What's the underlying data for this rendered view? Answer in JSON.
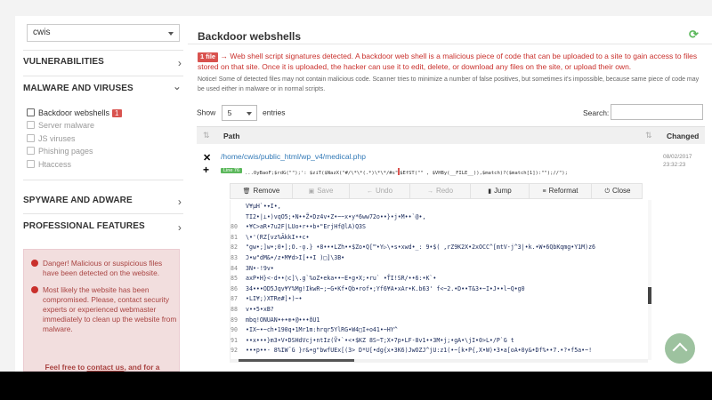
{
  "site_select": {
    "value": "cwis"
  },
  "sidebar": {
    "sections": [
      {
        "label": "VULNERABILITIES",
        "chevron": "›"
      },
      {
        "label": "MALWARE AND VIRUSES",
        "chevron": "⌄"
      },
      {
        "label": "SPYWARE AND ADWARE",
        "chevron": "›"
      },
      {
        "label": "PROFESSIONAL FEATURES",
        "chevron": "›"
      }
    ],
    "malware_items": [
      {
        "label": "Backdoor webshells",
        "badge": "1"
      },
      {
        "label": "Server malware"
      },
      {
        "label": "JS viruses"
      },
      {
        "label": "Phishing pages"
      },
      {
        "label": "Htaccess"
      }
    ]
  },
  "alert": {
    "line1": "Danger! Malicious or suspicious files have been detected on the website.",
    "line2": "Most likely the website has been compromised. Please, contact security experts or experienced webmaster immediately to clean up the website from malware.",
    "foot_prefix": "Feel free to ",
    "foot_link": "contact us",
    "foot_suffix": ", and for a reasonable fee we will be glad to help you!"
  },
  "main": {
    "title": "Backdoor webshells",
    "files_badge": "1 file",
    "description": "→ Web shell script signatures detected. A backdoor web shell is a malicious piece of code that can be uploaded to a site to gain access to files stored on that site. Once it is uploaded, the hacker can use it to edit, delete, or download any files on the site, or upload their own.",
    "notice": "Notice! Some of detected files may not contain malicious code. Scanner tries to minimize a number of false positives, but sometimes it's impossible, because same piece of code may be used either in malware or in normal scripts.",
    "show_label": "Show",
    "show_value": "5",
    "entries_label": "entries",
    "search_label": "Search:"
  },
  "table": {
    "col_path": "Path",
    "col_changed": "Changed",
    "row": {
      "path": "/home/cwis/public_html/wp_v4/medical.php",
      "line_badge": "Line 76",
      "code_before": "...OyBaoF;$rdG(\"\");': $ziT($NazX(\"#/\\*\\*(.*)\\*\\*/#s\"",
      "code_after": "$EfST(\"\" , $VHBy(__FILE__)),$match)?($match[1]):\"\");//\");",
      "date": "08/02/2017",
      "time": "23:32:23"
    }
  },
  "toolbar": {
    "remove": "Remove",
    "save": "Save",
    "undo": "Undo",
    "redo": "Redo",
    "jump": "Jump",
    "reformat": "Reformat",
    "close": "Close"
  },
  "code_lines": [
    {
      "n": "",
      "t": "V¥µH`•▾I•,"
    },
    {
      "n": "",
      "t": "TI2•|⊥•)vqO5;•N••Z̃•Dz4v•Z•~~x•y*6ww72o••}•j•M••`@•,"
    },
    {
      "n": "80",
      "t": "•¥C>aR•7u2F|LUo•r••b•\"ErjHf@lA)Q3S"
    },
    {
      "n": "81",
      "t": "\\•'(RZ[vz%ÃkkI••c•"
    },
    {
      "n": "82",
      "t": "\"gw•;]w•;0•];O.-ǫ.}  •8•••LZh••$Zo•Q[™•Y▷\\•s•xwd•_: 9•$( ,rZ9K2X•2xOCC^[mtV-j^3|•k.•W•6QbKqmg•Y1M)z6"
    },
    {
      "n": "83",
      "t": "Ͻ•w\"dM&•/z•M¥d>I[••I  )□]\\3B•"
    },
    {
      "n": "84",
      "t": "3N•-!9v•"
    },
    {
      "n": "85",
      "t": "axP•H}<-d••◊c]\\.g`%oZ•eka••~E•g•X;•ru` •ŤI!SR/••6:•K`•"
    },
    {
      "n": "86",
      "t": "34•••OD5Jqv¥Y%Mg!IkwR~;~G•Kf•Qb•rof•;Yf6¥A•xAr•K.b63' f<~2.•D••T&3•~I•J••l~Q•g0"
    },
    {
      "n": "87",
      "t": "•LI¥;)XTRe#]•)~•"
    },
    {
      "n": "88",
      "t": "v••5•xB?"
    },
    {
      "n": "89",
      "t": "mbq!ONUAN•+•⊕•@•••ðU1"
    },
    {
      "n": "90",
      "t": "•IX~•~ch•190q•1Mr1m:hrqr5YlRG•W4□I+o41•~HY^"
    },
    {
      "n": "91",
      "t": "••x•••}m3•V•DSHdVcj•ntIz(Ṽ•`•<•$KZ 8S~T;X•7p•LF-8v1••3M•j;•gA•\\jI•0>L•/P`G t"
    },
    {
      "n": "92",
      "t": "•••p••-  8%IW¯G }r&•g\"bwfUEx[(3> D*U[•dg{x•3K6)JwOZJ^jU:z1(•~[k•P{,X•W)•3•a[oA•0y&•Df%••7.•?•f5a•~!"
    }
  ]
}
